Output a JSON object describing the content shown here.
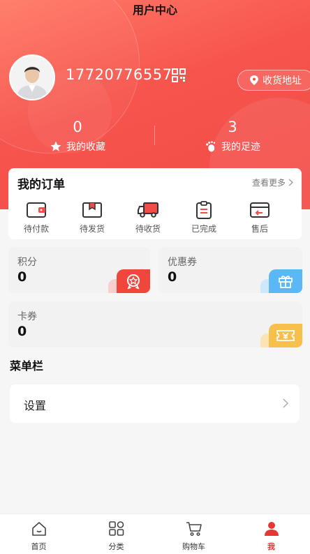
{
  "header": {
    "title": "用户中心"
  },
  "profile": {
    "phone": "17720776557",
    "address_button": "收货地址"
  },
  "stats": [
    {
      "count": "0",
      "label": "我的收藏",
      "icon": "star-icon"
    },
    {
      "count": "3",
      "label": "我的足迹",
      "icon": "footprint-icon"
    }
  ],
  "orders": {
    "title": "我的订单",
    "more": "查看更多",
    "items": [
      {
        "label": "待付款",
        "icon": "wallet-icon"
      },
      {
        "label": "待发货",
        "icon": "box-icon"
      },
      {
        "label": "待收货",
        "icon": "truck-icon"
      },
      {
        "label": "已完成",
        "icon": "clipboard-icon"
      },
      {
        "label": "售后",
        "icon": "return-icon"
      }
    ]
  },
  "assets": {
    "points": {
      "label": "积分",
      "value": "0",
      "icon": "medal-icon",
      "color": "#f0463c"
    },
    "coupons": {
      "label": "优惠券",
      "value": "0",
      "icon": "gift-icon",
      "color": "#5bb7f5"
    },
    "cards": {
      "label": "卡券",
      "value": "0",
      "icon": "ticket-icon",
      "color": "#f7c04d"
    }
  },
  "menu": {
    "title": "菜单栏",
    "items": [
      {
        "label": "设置"
      }
    ]
  },
  "tabbar": {
    "items": [
      {
        "label": "首页",
        "icon": "home-icon"
      },
      {
        "label": "分类",
        "icon": "category-icon"
      },
      {
        "label": "购物车",
        "icon": "cart-icon"
      },
      {
        "label": "我",
        "icon": "user-icon",
        "active": true
      }
    ]
  },
  "colors": {
    "brand": "#f24c46",
    "active_tab": "#e63636"
  }
}
